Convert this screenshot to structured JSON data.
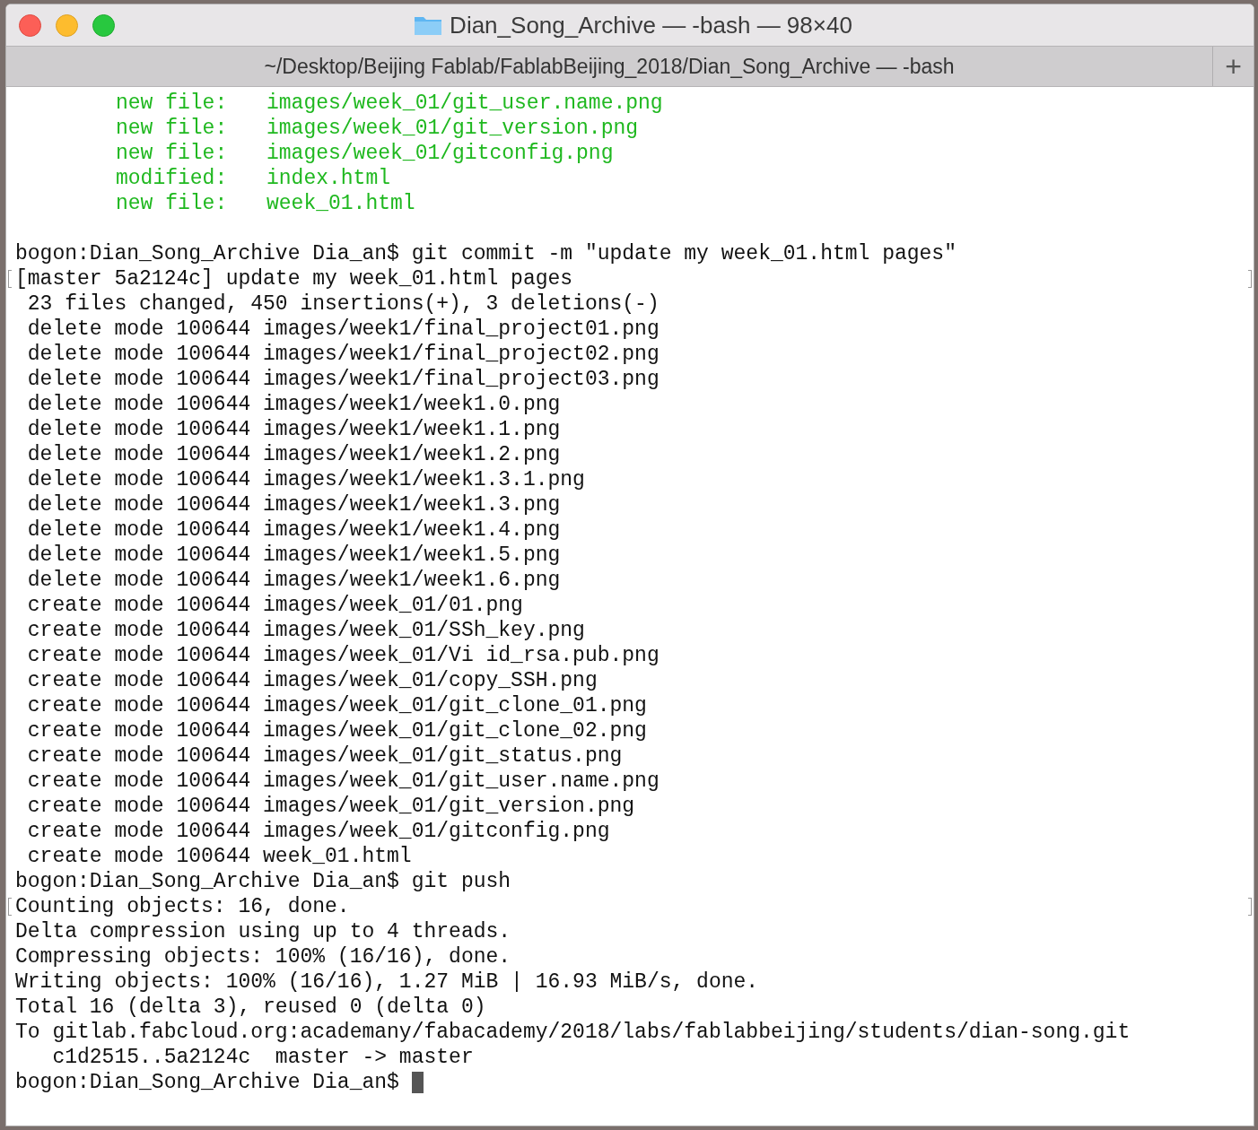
{
  "window": {
    "title": "Dian_Song_Archive — -bash — 98×40"
  },
  "tab": {
    "label": "~/Desktop/Beijing Fablab/FablabBeijing_2018/Dian_Song_Archive — -bash",
    "add_button": "+"
  },
  "lines": [
    {
      "kind": "status",
      "label": "new file:",
      "path": "images/week_01/git_user.name.png"
    },
    {
      "kind": "status",
      "label": "new file:",
      "path": "images/week_01/git_version.png"
    },
    {
      "kind": "status",
      "label": "new file:",
      "path": "images/week_01/gitconfig.png"
    },
    {
      "kind": "status",
      "label": "modified:",
      "path": "index.html"
    },
    {
      "kind": "status",
      "label": "new file:",
      "path": "week_01.html"
    },
    {
      "kind": "blank"
    },
    {
      "kind": "plain",
      "text": "bogon:Dian_Song_Archive Dia_an$ git commit -m \"update my week_01.html pages\"",
      "marked": false,
      "cursor": false
    },
    {
      "kind": "plain",
      "text": "[master 5a2124c] update my week_01.html pages",
      "marked": true,
      "cursor": false
    },
    {
      "kind": "plain",
      "text": " 23 files changed, 450 insertions(+), 3 deletions(-)",
      "marked": false,
      "cursor": false
    },
    {
      "kind": "plain",
      "text": " delete mode 100644 images/week1/final_project01.png",
      "marked": false,
      "cursor": false
    },
    {
      "kind": "plain",
      "text": " delete mode 100644 images/week1/final_project02.png",
      "marked": false,
      "cursor": false
    },
    {
      "kind": "plain",
      "text": " delete mode 100644 images/week1/final_project03.png",
      "marked": false,
      "cursor": false
    },
    {
      "kind": "plain",
      "text": " delete mode 100644 images/week1/week1.0.png",
      "marked": false,
      "cursor": false
    },
    {
      "kind": "plain",
      "text": " delete mode 100644 images/week1/week1.1.png",
      "marked": false,
      "cursor": false
    },
    {
      "kind": "plain",
      "text": " delete mode 100644 images/week1/week1.2.png",
      "marked": false,
      "cursor": false
    },
    {
      "kind": "plain",
      "text": " delete mode 100644 images/week1/week1.3.1.png",
      "marked": false,
      "cursor": false
    },
    {
      "kind": "plain",
      "text": " delete mode 100644 images/week1/week1.3.png",
      "marked": false,
      "cursor": false
    },
    {
      "kind": "plain",
      "text": " delete mode 100644 images/week1/week1.4.png",
      "marked": false,
      "cursor": false
    },
    {
      "kind": "plain",
      "text": " delete mode 100644 images/week1/week1.5.png",
      "marked": false,
      "cursor": false
    },
    {
      "kind": "plain",
      "text": " delete mode 100644 images/week1/week1.6.png",
      "marked": false,
      "cursor": false
    },
    {
      "kind": "plain",
      "text": " create mode 100644 images/week_01/01.png",
      "marked": false,
      "cursor": false
    },
    {
      "kind": "plain",
      "text": " create mode 100644 images/week_01/SSh_key.png",
      "marked": false,
      "cursor": false
    },
    {
      "kind": "plain",
      "text": " create mode 100644 images/week_01/Vi id_rsa.pub.png",
      "marked": false,
      "cursor": false
    },
    {
      "kind": "plain",
      "text": " create mode 100644 images/week_01/copy_SSH.png",
      "marked": false,
      "cursor": false
    },
    {
      "kind": "plain",
      "text": " create mode 100644 images/week_01/git_clone_01.png",
      "marked": false,
      "cursor": false
    },
    {
      "kind": "plain",
      "text": " create mode 100644 images/week_01/git_clone_02.png",
      "marked": false,
      "cursor": false
    },
    {
      "kind": "plain",
      "text": " create mode 100644 images/week_01/git_status.png",
      "marked": false,
      "cursor": false
    },
    {
      "kind": "plain",
      "text": " create mode 100644 images/week_01/git_user.name.png",
      "marked": false,
      "cursor": false
    },
    {
      "kind": "plain",
      "text": " create mode 100644 images/week_01/git_version.png",
      "marked": false,
      "cursor": false
    },
    {
      "kind": "plain",
      "text": " create mode 100644 images/week_01/gitconfig.png",
      "marked": false,
      "cursor": false
    },
    {
      "kind": "plain",
      "text": " create mode 100644 week_01.html",
      "marked": false,
      "cursor": false
    },
    {
      "kind": "plain",
      "text": "bogon:Dian_Song_Archive Dia_an$ git push",
      "marked": false,
      "cursor": false
    },
    {
      "kind": "plain",
      "text": "Counting objects: 16, done.",
      "marked": true,
      "cursor": false
    },
    {
      "kind": "plain",
      "text": "Delta compression using up to 4 threads.",
      "marked": false,
      "cursor": false
    },
    {
      "kind": "plain",
      "text": "Compressing objects: 100% (16/16), done.",
      "marked": false,
      "cursor": false
    },
    {
      "kind": "plain",
      "text": "Writing objects: 100% (16/16), 1.27 MiB | 16.93 MiB/s, done.",
      "marked": false,
      "cursor": false
    },
    {
      "kind": "plain",
      "text": "Total 16 (delta 3), reused 0 (delta 0)",
      "marked": false,
      "cursor": false
    },
    {
      "kind": "plain",
      "text": "To gitlab.fabcloud.org:academany/fabacademy/2018/labs/fablabbeijing/students/dian-song.git",
      "marked": false,
      "cursor": false
    },
    {
      "kind": "plain",
      "text": "   c1d2515..5a2124c  master -> master",
      "marked": false,
      "cursor": false
    },
    {
      "kind": "plain",
      "text": "bogon:Dian_Song_Archive Dia_an$ ",
      "marked": false,
      "cursor": true
    }
  ]
}
